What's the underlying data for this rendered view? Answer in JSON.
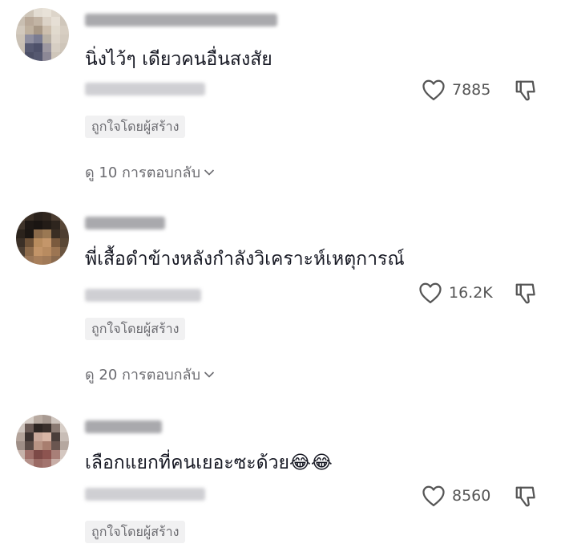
{
  "comments": [
    {
      "text": "นิ่งไว้ๆ เดียวคนอื่นสงสัย",
      "likes": "7885",
      "creator_badge": "ถูกใจโดยผู้สร้าง",
      "replies": "ดู 10 การตอบกลับ"
    },
    {
      "text": "พี่เสื้อดำข้างหลังกำลังวิเคราะห์เหตุการณ์",
      "likes": "16.2K",
      "creator_badge": "ถูกใจโดยผู้สร้าง",
      "replies": "ดู 20 การตอบกลับ"
    },
    {
      "text": "เลือกแยกที่คนเยอะซะด้วย😂😂",
      "likes": "8560",
      "creator_badge": "ถูกใจโดยผู้สร้าง"
    }
  ],
  "icons": {
    "like": "heart-outline-icon",
    "dislike": "thumbs-down-outline-icon",
    "replies_chevron": "chevron-down-icon"
  },
  "colors": {
    "text": "#161823",
    "muted": "#6b6b70",
    "badge_bg": "#f1f1f2"
  }
}
